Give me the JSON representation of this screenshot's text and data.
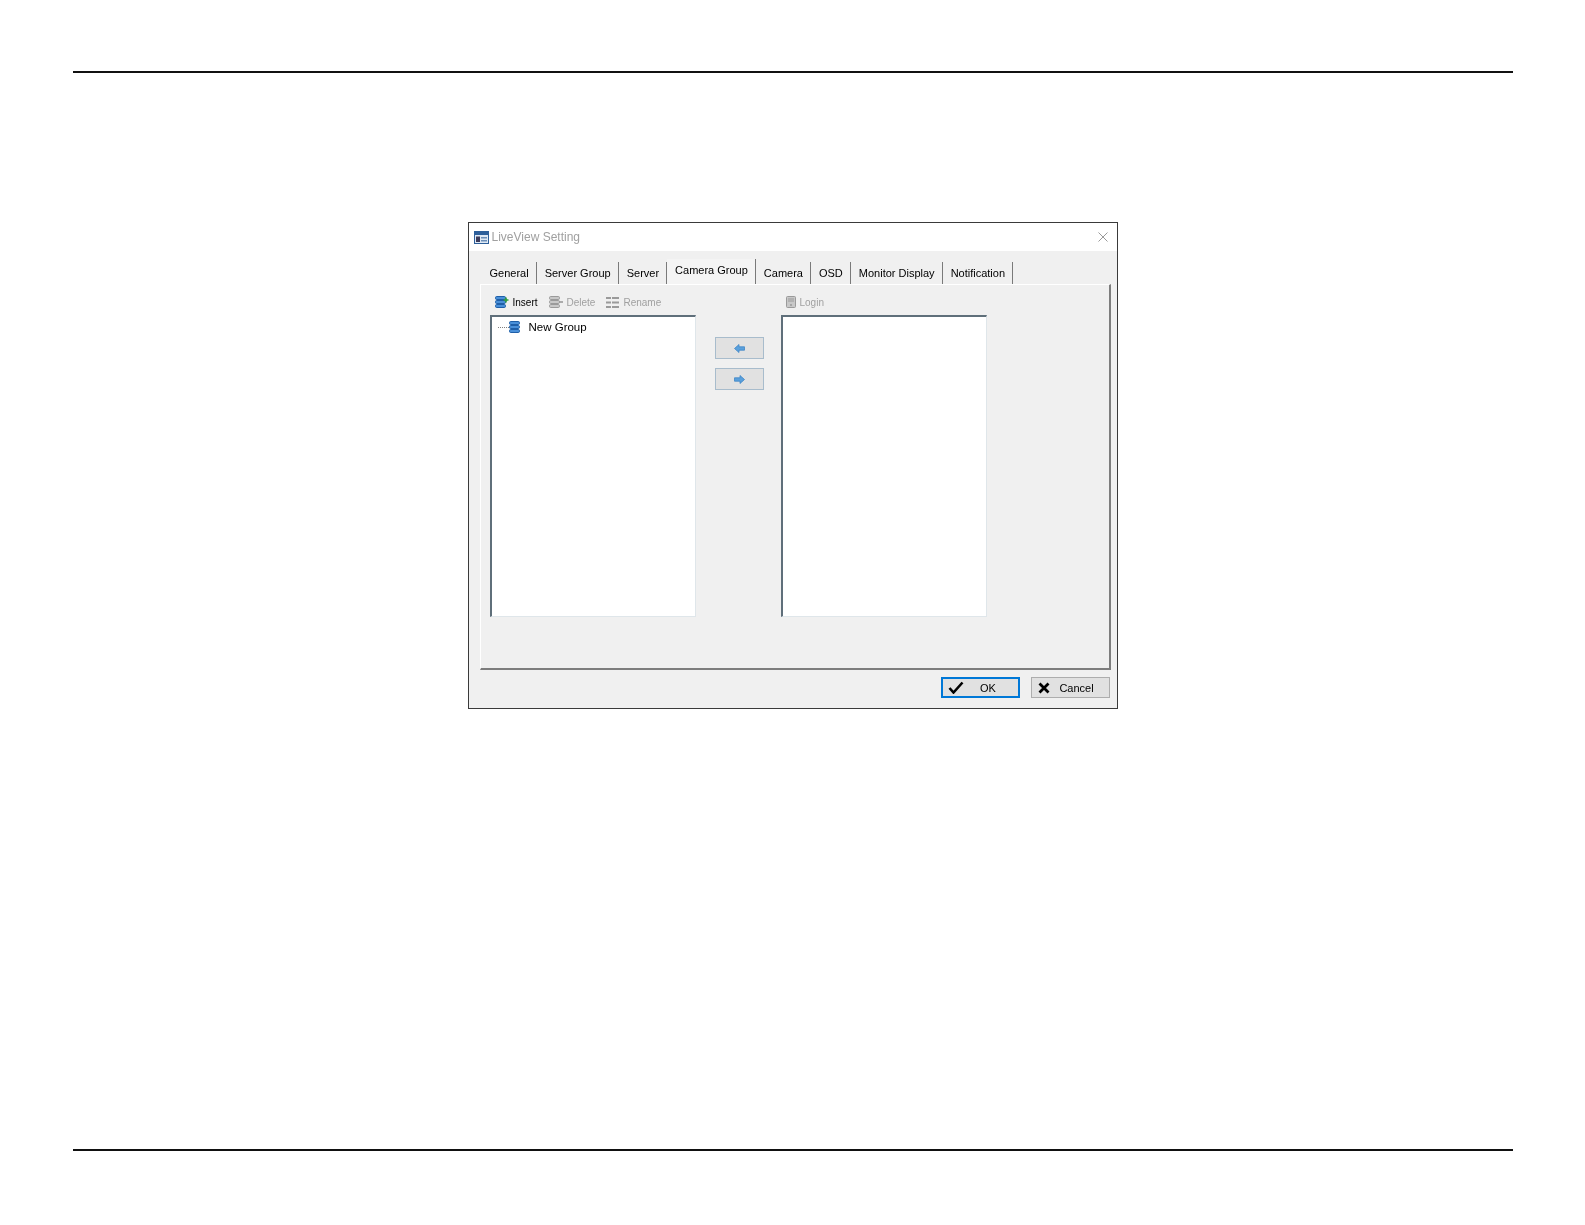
{
  "window": {
    "title": "LiveView Setting",
    "active": false
  },
  "tabs": [
    {
      "label": "General",
      "selected": false
    },
    {
      "label": "Server Group",
      "selected": false
    },
    {
      "label": "Server",
      "selected": false
    },
    {
      "label": "Camera Group",
      "selected": true
    },
    {
      "label": "Camera",
      "selected": false
    },
    {
      "label": "OSD",
      "selected": false
    },
    {
      "label": "Monitor Display",
      "selected": false
    },
    {
      "label": "Notification",
      "selected": false
    }
  ],
  "group_panel": {
    "toolbar": [
      {
        "kind": "insert",
        "label": "Insert",
        "disabled": false
      },
      {
        "kind": "delete",
        "label": "Delete",
        "disabled": true
      },
      {
        "kind": "rename",
        "label": "Rename",
        "disabled": true
      }
    ],
    "tree": [
      {
        "label": "New Group"
      }
    ]
  },
  "camera_panel": {
    "toolbar": [
      {
        "kind": "login",
        "label": "Login",
        "disabled": true
      }
    ]
  },
  "buttons": [
    {
      "kind": "ok",
      "label": "OK",
      "default": true
    },
    {
      "kind": "cancel",
      "label": "Cancel",
      "default": false
    }
  ]
}
